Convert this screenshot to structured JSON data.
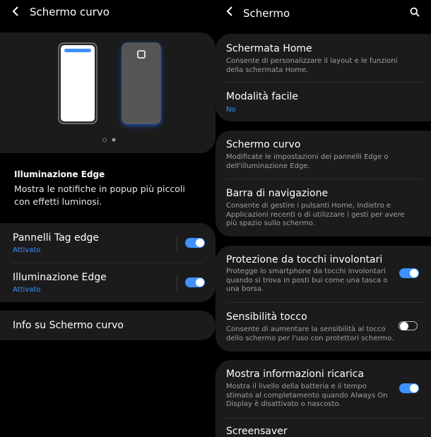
{
  "left": {
    "header": {
      "title": "Schermo curvo"
    },
    "preview": {
      "dots": 2,
      "active_dot": 1
    },
    "description": {
      "title": "Illuminazione Edge",
      "text": "Mostra le notifiche in popup più piccoli con effetti luminosi."
    },
    "settings": [
      {
        "label": "Pannelli Tag edge",
        "status": "Attivato",
        "on": true
      },
      {
        "label": "Illuminazione Edge",
        "status": "Attivato",
        "on": true
      }
    ],
    "info": {
      "label": "Info su Schermo curvo"
    }
  },
  "right": {
    "header": {
      "title": "Schermo"
    },
    "groups": [
      {
        "items": [
          {
            "title": "Schermata Home",
            "desc": "Consente di personalizzare il layout e le funzioni della schermata Home."
          },
          {
            "title": "Modalità facile",
            "sub": "No"
          }
        ]
      },
      {
        "items": [
          {
            "title": "Schermo curvo",
            "desc": "Modificate le impostazioni dei pannelli Edge o dell'illuminazione Edge."
          },
          {
            "title": "Barra di navigazione",
            "desc": "Consente di gestire i pulsanti Home, Indietro e Applicazioni recenti o di utilizzare i gesti per avere più spazio sullo schermo."
          }
        ]
      },
      {
        "items": [
          {
            "title": "Protezione da tocchi involontari",
            "desc": "Protegge lo smartphone da tocchi involontari quando si trova in posti bui come una tasca o una borsa.",
            "toggle": true
          },
          {
            "title": "Sensibilità tocco",
            "desc": "Consente di aumentare la sensibilità al tocco dello schermo per l'uso con protettori schermo.",
            "toggle": false
          }
        ]
      },
      {
        "items": [
          {
            "title": "Mostra informazioni ricarica",
            "desc": "Mostra il livello della batteria e il tempo stimato al completamento quando Always On Display è disattivato o nascosto.",
            "toggle": true
          },
          {
            "title": "Screensaver"
          }
        ]
      }
    ]
  },
  "colors": {
    "accent": "#3e91ff",
    "card": "#1b1b1b",
    "background": "#000000"
  }
}
